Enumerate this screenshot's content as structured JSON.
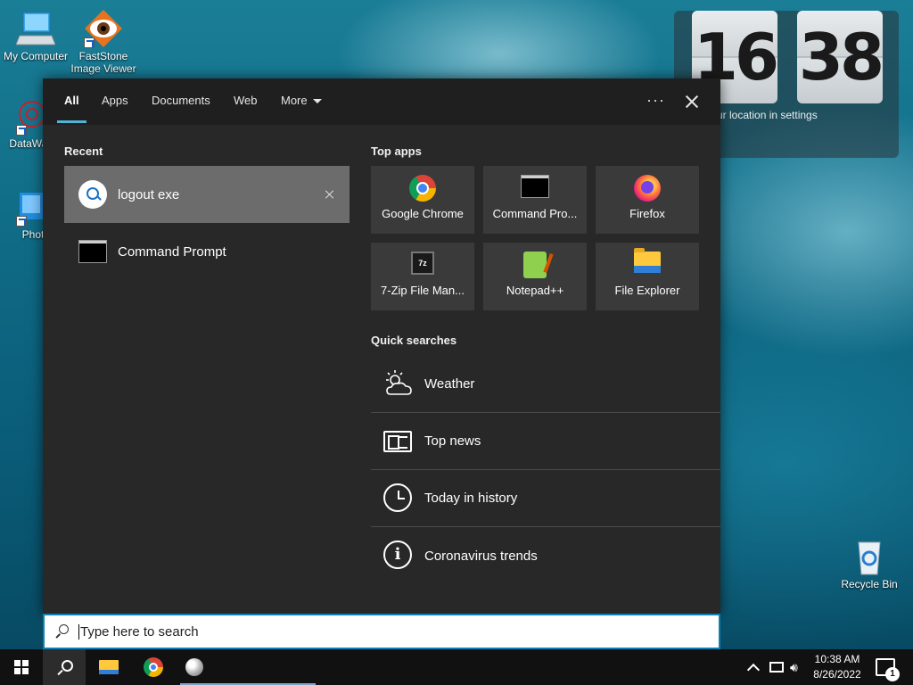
{
  "desktop": {
    "icons": [
      {
        "label": "My Computer"
      },
      {
        "label": "FastStone Image Viewer"
      },
      {
        "label": "DataWag"
      },
      {
        "label": "Photo"
      },
      {
        "label": "Recycle Bin"
      }
    ],
    "clock": {
      "hour": "16",
      "minute": "38",
      "location_hint": "ur location in settings"
    }
  },
  "search_panel": {
    "tabs": [
      {
        "label": "All",
        "active": true
      },
      {
        "label": "Apps"
      },
      {
        "label": "Documents"
      },
      {
        "label": "Web"
      },
      {
        "label": "More"
      }
    ],
    "more_options": "···",
    "recent": {
      "title": "Recent",
      "items": [
        {
          "label": "logout exe",
          "icon": "search-icon",
          "selected": true
        },
        {
          "label": "Command Prompt",
          "icon": "command-prompt-icon"
        }
      ]
    },
    "top_apps": {
      "title": "Top apps",
      "items": [
        {
          "label": "Google Chrome",
          "icon": "chrome-icon"
        },
        {
          "label": "Command Pro...",
          "icon": "command-prompt-icon"
        },
        {
          "label": "Firefox",
          "icon": "firefox-icon"
        },
        {
          "label": "7-Zip File Man...",
          "icon": "7zip-icon",
          "badge": "7z"
        },
        {
          "label": "Notepad++",
          "icon": "notepad-plus-plus-icon"
        },
        {
          "label": "File Explorer",
          "icon": "file-explorer-icon"
        }
      ]
    },
    "quick_searches": {
      "title": "Quick searches",
      "items": [
        {
          "label": "Weather",
          "icon": "weather-icon"
        },
        {
          "label": "Top news",
          "icon": "news-icon"
        },
        {
          "label": "Today in history",
          "icon": "clock-icon"
        },
        {
          "label": "Coronavirus trends",
          "icon": "info-icon"
        }
      ]
    }
  },
  "search_box": {
    "placeholder": "Type here to search",
    "value": ""
  },
  "taskbar": {
    "time": "10:38 AM",
    "date": "8/26/2022",
    "notification_count": "1"
  },
  "colors": {
    "accent": "#52b3d9",
    "panel_bg": "#282828",
    "tile_bg": "#3a3a3a",
    "selected_bg": "#6c6c6c"
  }
}
